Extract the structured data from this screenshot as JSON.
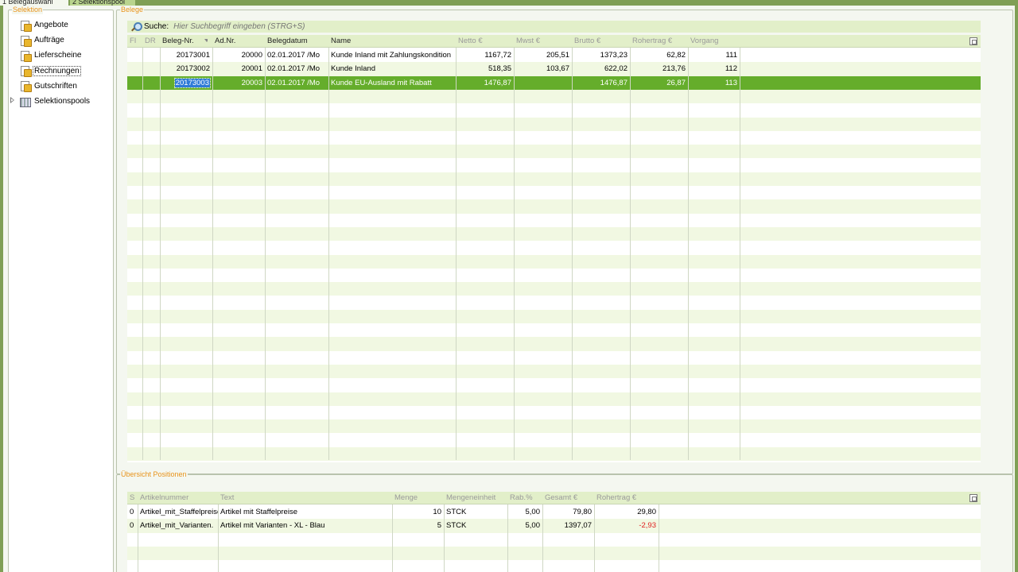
{
  "tabs": [
    {
      "label": "1 Belegauswahl"
    },
    {
      "label": "2 Selektionspool"
    }
  ],
  "selection": {
    "title": "Selektion",
    "items": [
      {
        "label": "Angebote"
      },
      {
        "label": "Aufträge"
      },
      {
        "label": "Lieferscheine"
      },
      {
        "label": "Rechnungen",
        "selected": true
      },
      {
        "label": "Gutschriften"
      },
      {
        "label": "Selektionspools",
        "expandable": true
      }
    ]
  },
  "belege": {
    "title": "Belege",
    "search_label": "Suche:",
    "search_placeholder": "Hier Suchbegriff eingeben (STRG+S)",
    "columns": [
      "FI",
      "DR",
      "Beleg-Nr.",
      "Ad.Nr.",
      "Belegdatum",
      "Name",
      "Netto €",
      "Mwst €",
      "Brutto €",
      "Rohertrag €",
      "Vorgang"
    ],
    "rows": [
      {
        "fi": "",
        "dr": "",
        "beleg_nr": "20173001",
        "ad_nr": "20000",
        "belegdatum": "02.01.2017 /Mo",
        "name": "Kunde Inland mit Zahlungskondition",
        "netto": "1167,72",
        "mwst": "205,51",
        "brutto": "1373,23",
        "rohertrag": "62,82",
        "vorgang": "111"
      },
      {
        "fi": "",
        "dr": "",
        "beleg_nr": "20173002",
        "ad_nr": "20001",
        "belegdatum": "02.01.2017 /Mo",
        "name": "Kunde Inland",
        "netto": "518,35",
        "mwst": "103,67",
        "brutto": "622,02",
        "rohertrag": "213,76",
        "vorgang": "112"
      },
      {
        "fi": "",
        "dr": "",
        "beleg_nr": "20173003",
        "ad_nr": "20003",
        "belegdatum": "02.01.2017 /Mo",
        "name": "Kunde EU-Ausland mit Rabatt",
        "netto": "1476,87",
        "mwst": "",
        "brutto": "1476,87",
        "rohertrag": "26,87",
        "vorgang": "113",
        "selected": true
      }
    ]
  },
  "positionen": {
    "title": "Übersicht Positionen",
    "columns": [
      "S",
      "Artikelnummer",
      "Text",
      "Menge",
      "Mengeneinheit",
      "Rab.%",
      "Gesamt €",
      "Rohertrag €"
    ],
    "rows": [
      {
        "s": "0",
        "artikelnummer": "Artikel_mit_Staffelpreise",
        "text": "Artikel mit Staffelpreise",
        "menge": "10",
        "einheit": "STCK",
        "rabatt": "5,00",
        "gesamt": "79,80",
        "rohertrag": "29,80",
        "negative": false
      },
      {
        "s": "0",
        "artikelnummer": "Artikel_mit_Varianten.",
        "text": "Artikel mit Varianten - XL - Blau",
        "menge": "5",
        "einheit": "STCK",
        "rabatt": "5,00",
        "gesamt": "1397,07",
        "rohertrag": "-2,93",
        "negative": true
      }
    ]
  },
  "colors": {
    "accent": "#65ad2b",
    "frame": "#7f9f55",
    "header": "#e2efc9",
    "alt_row": "#f1f8e2",
    "group_title": "#e8931a",
    "negative": "#e02020"
  }
}
